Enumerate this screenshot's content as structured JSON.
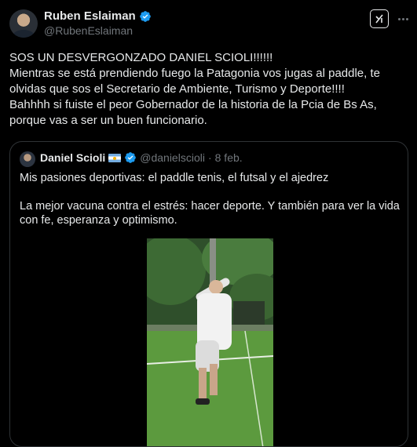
{
  "author": {
    "name": "Ruben Eslaiman",
    "handle": "@RubenEslaiman",
    "verified": true
  },
  "tweet": {
    "lines": [
      "SOS UN DESVERGONZADO DANIEL SCIOLI!!!!!!",
      "Mientras se está prendiendo fuego la Patagonia vos jugas al paddle, te olvidas que sos el Secretario de Ambiente, Turismo y Deporte!!!!",
      "Bahhhh si fuiste el peor Gobernador de la historia de la Pcia de Bs As, porque vas a ser un buen funcionario."
    ]
  },
  "quoted": {
    "name": "Daniel Scioli",
    "flag": "argentina-flag",
    "verified": true,
    "handle": "@danielscioli",
    "separator": "·",
    "date": "8 feb.",
    "paragraphs": [
      "Mis pasiones deportivas: el paddle tenis, el futsal y el ajedrez",
      "La mejor vacuna contra el estrés: hacer deporte. Y también para ver la vida con fe, esperanza y optimismo."
    ],
    "media": "video-thumbnail"
  },
  "icons": {
    "verified_color": "#1d9bf0",
    "grok": "grok-icon",
    "more": "more-icon"
  }
}
